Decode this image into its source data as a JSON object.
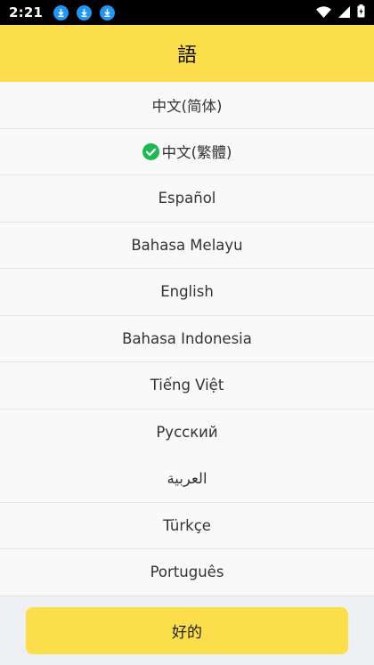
{
  "status_bar": {
    "time": "2:21",
    "icons": [
      "download-icon",
      "download-icon",
      "download-icon",
      "wifi-icon",
      "cell-signal-icon",
      "battery-icon"
    ]
  },
  "header": {
    "title": "語"
  },
  "languages": [
    {
      "label": "中文(简体)",
      "selected": false
    },
    {
      "label": "中文(繁體)",
      "selected": true
    },
    {
      "label": "Español",
      "selected": false
    },
    {
      "label": "Bahasa Melayu",
      "selected": false
    },
    {
      "label": "English",
      "selected": false
    },
    {
      "label": "Bahasa Indonesia",
      "selected": false
    },
    {
      "label": "Tiếng Việt",
      "selected": false
    },
    {
      "label": "Русский",
      "selected": false
    },
    {
      "label": "العربية",
      "selected": false
    },
    {
      "label": "Türkçe",
      "selected": false
    },
    {
      "label": "Português",
      "selected": false
    }
  ],
  "footer": {
    "ok_label": "好的"
  },
  "colors": {
    "accent": "#fcde4c",
    "check": "#1db954",
    "download_badge": "#2196f3"
  }
}
